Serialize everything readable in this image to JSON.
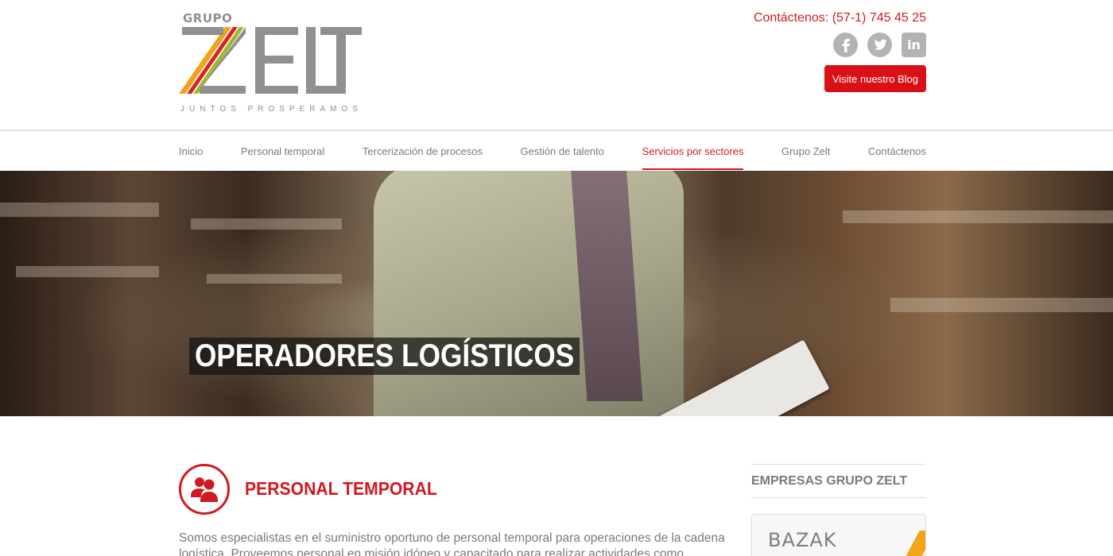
{
  "header": {
    "logo": {
      "top_text": "GRUPO",
      "main_text": "ZELT",
      "tagline": "JUNTOS PROSPERAMOS"
    },
    "contact_text": "Contáctenos: (57-1) 745 45 25",
    "social": [
      {
        "icon": "facebook-icon",
        "glyph": "f"
      },
      {
        "icon": "twitter-icon",
        "glyph": "t"
      },
      {
        "icon": "linkedin-icon",
        "glyph": "in"
      }
    ],
    "blog_button": "Visite nuestro Blog"
  },
  "nav": {
    "items": [
      {
        "label": "Inicio"
      },
      {
        "label": "Personal temporal"
      },
      {
        "label": "Tercerización de procesos"
      },
      {
        "label": "Gestión de talento"
      },
      {
        "label": "Servicios por sectores",
        "active": true
      },
      {
        "label": "Grupo Zelt"
      },
      {
        "label": "Contáctenos"
      }
    ]
  },
  "hero": {
    "title": "OPERADORES LOGÍSTICOS"
  },
  "main": {
    "section_icon": "people-icon",
    "section_title": "PERSONAL TEMPORAL",
    "body": "Somos especialistas en el suministro oportuno de personal temporal para operaciones de la cadena logística. Proveemos personal en misión idóneo y capacitado para realizar actividades como procesamiento de"
  },
  "sidebar": {
    "heading": "EMPRESAS GRUPO ZELT",
    "card_logo": "BAZAK"
  },
  "colors": {
    "accent": "#d11a1f",
    "text": "#7a7a7a",
    "logo_gray": "#8f8f8f"
  }
}
